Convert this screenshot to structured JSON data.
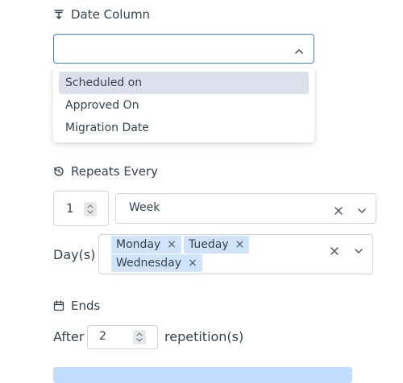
{
  "date_column": {
    "label": "Date Column",
    "value": "",
    "options": [
      "Scheduled on",
      "Approved On",
      "Migration Date"
    ],
    "highlighted": "Scheduled on"
  },
  "repeats": {
    "label": "Repeats Every",
    "interval": "1",
    "unit": "Week"
  },
  "days": {
    "label": "Day(s)",
    "selected": [
      "Monday",
      "Tueday",
      "Wednesday"
    ]
  },
  "ends": {
    "label": "Ends",
    "prefix": "After",
    "count": "2",
    "suffix": "repetition(s)"
  },
  "colors": {
    "accent": "#3b82f6",
    "chip_bg": "#cfe4fb",
    "highlight_bg": "#dde0ec",
    "banner_bg": "#bfdbfe"
  }
}
